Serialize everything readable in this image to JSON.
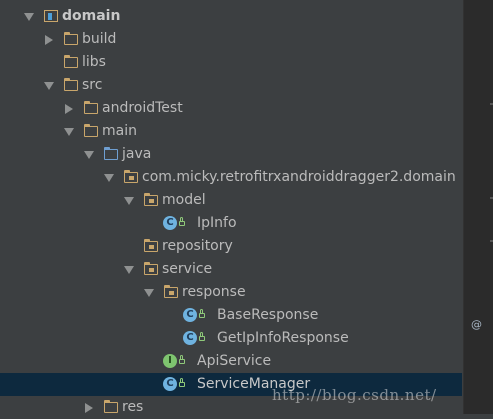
{
  "tree": {
    "root": {
      "label": "domain"
    },
    "build": {
      "label": "build"
    },
    "libs": {
      "label": "libs"
    },
    "src": {
      "label": "src"
    },
    "androidTest": {
      "label": "androidTest"
    },
    "main": {
      "label": "main"
    },
    "java": {
      "label": "java"
    },
    "package": {
      "label": "com.micky.retrofitrxandroiddragger2.domain"
    },
    "model": {
      "label": "model"
    },
    "ipinfo": {
      "label": "IpInfo",
      "badge": "C"
    },
    "repository": {
      "label": "repository"
    },
    "service": {
      "label": "service"
    },
    "response": {
      "label": "response"
    },
    "base_response": {
      "label": "BaseResponse",
      "badge": "C"
    },
    "getipinfo_response": {
      "label": "GetIpInfoResponse",
      "badge": "C"
    },
    "api_service": {
      "label": "ApiService",
      "badge": "I"
    },
    "service_manager": {
      "label": "ServiceManager",
      "badge": "C",
      "selected": true
    },
    "res": {
      "label": "res"
    }
  },
  "gutter": {
    "marker": "@"
  },
  "watermark": "http://blog.csdn.net/",
  "colors": {
    "panel_bg": "#3c3f41",
    "selection_bg": "#0d293e",
    "folder": "#c9a66b",
    "source_folder": "#6f9fd1",
    "class_badge": "#6fb3e0",
    "interface_badge": "#7ec46f"
  }
}
